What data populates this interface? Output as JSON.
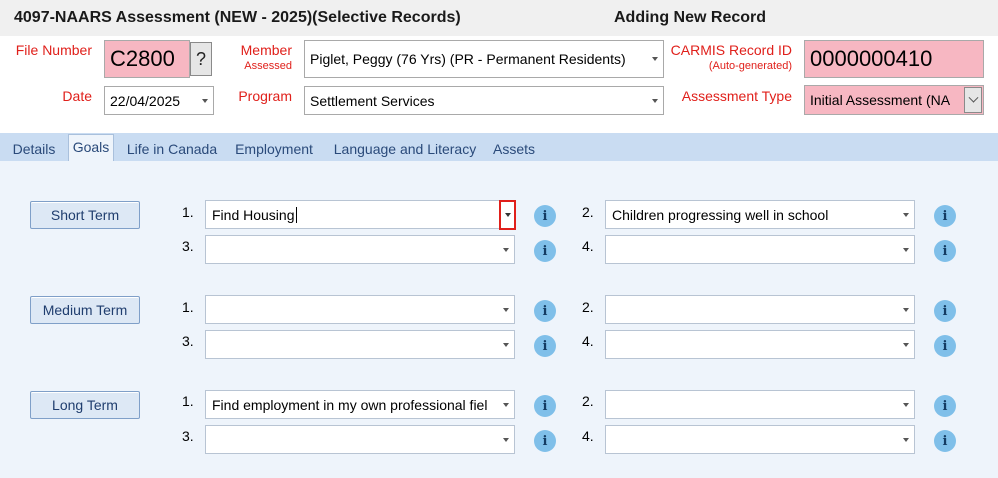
{
  "header": {
    "title": "4097-NAARS Assessment (NEW - 2025)(Selective Records)",
    "mode": "Adding New Record"
  },
  "form": {
    "file_number_label": "File Number",
    "file_number": "C2800",
    "lookup_button": "?",
    "date_label": "Date",
    "date": "22/04/2025",
    "member_label": "Member",
    "member_sublabel": "Assessed",
    "member": "Piglet, Peggy (76 Yrs) (PR - Permanent Residents)",
    "program_label": "Program",
    "program": "Settlement Services",
    "carmis_label": "CARMIS Record ID",
    "carmis_sublabel": "(Auto-generated)",
    "carmis_id": "0000000410",
    "assessment_type_label": "Assessment Type",
    "assessment_type": "Initial Assessment (NA"
  },
  "tabs": [
    {
      "label": "Details",
      "active": false
    },
    {
      "label": "Goals",
      "active": true
    },
    {
      "label": "Life in Canada",
      "active": false
    },
    {
      "label": "Employment",
      "active": false
    },
    {
      "label": "Language and Literacy",
      "active": false
    },
    {
      "label": "Assets",
      "active": false
    }
  ],
  "goals": {
    "info_glyph": "i",
    "short_term": {
      "label": "Short Term",
      "nums": [
        "1.",
        "2.",
        "3.",
        "4."
      ],
      "values": [
        "Find Housing",
        "Children progressing well in school",
        "",
        ""
      ]
    },
    "medium_term": {
      "label": "Medium Term",
      "nums": [
        "1.",
        "2.",
        "3.",
        "4."
      ],
      "values": [
        "",
        "",
        "",
        ""
      ]
    },
    "long_term": {
      "label": "Long Term",
      "nums": [
        "1.",
        "2.",
        "3.",
        "4."
      ],
      "values": [
        "Find employment in my own professional fiel",
        "",
        "",
        ""
      ]
    }
  },
  "colors": {
    "label_red": "#e0201b",
    "required_pink": "#f7b7c2",
    "tab_strip": "#c9dcf2",
    "panel": "#eef4fb",
    "info_blue": "#7fbfe9"
  }
}
